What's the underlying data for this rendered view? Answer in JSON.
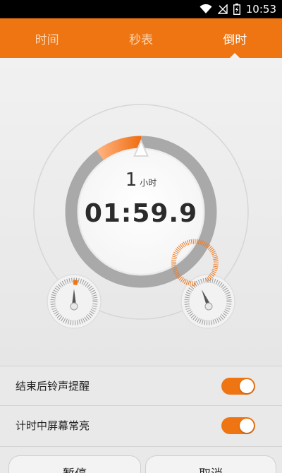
{
  "status_bar": {
    "time": "10:53",
    "icons": [
      "wifi-icon",
      "no-signal-icon",
      "battery-icon"
    ]
  },
  "tabs": [
    {
      "label": "时间",
      "active": false
    },
    {
      "label": "秒表",
      "active": false
    },
    {
      "label": "倒时",
      "active": true
    }
  ],
  "timer": {
    "hours": "1",
    "hours_unit": "小时",
    "display": "01:59.9",
    "progress_fraction": 0.1
  },
  "settings": [
    {
      "label": "结束后铃声提醒",
      "enabled": true
    },
    {
      "label": "计时中屏幕常亮",
      "enabled": true
    }
  ],
  "buttons": {
    "pause": "暂停",
    "cancel": "取消"
  },
  "colors": {
    "accent": "#ee7512",
    "ring_gray": "#a9a9a9"
  }
}
